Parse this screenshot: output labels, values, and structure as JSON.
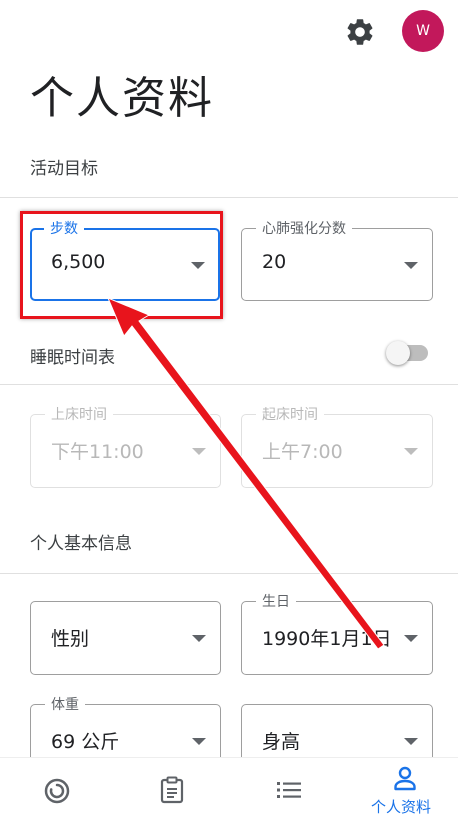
{
  "header": {
    "avatar_letter": "W",
    "page_title": "个人资料"
  },
  "goals": {
    "section_title": "活动目标",
    "steps": {
      "label": "步数",
      "value": "6,500"
    },
    "heart_points": {
      "label": "心肺强化分数",
      "value": "20"
    }
  },
  "sleep": {
    "section_title": "睡眠时间表",
    "toggle_on": false,
    "bedtime": {
      "label": "上床时间",
      "value": "下午11:00"
    },
    "wake_time": {
      "label": "起床时间",
      "value": "上午7:00"
    }
  },
  "basic_info": {
    "section_title": "个人基本信息",
    "gender": {
      "placeholder": "性别"
    },
    "birthday": {
      "label": "生日",
      "value": "1990年1月1日"
    },
    "weight": {
      "label": "体重",
      "value": "69 公斤"
    },
    "height": {
      "placeholder": "身高"
    }
  },
  "bottom_nav": {
    "items": [
      {
        "icon": "activity-ring-icon",
        "label": ""
      },
      {
        "icon": "journal-clipboard-icon",
        "label": ""
      },
      {
        "icon": "list-icon",
        "label": ""
      },
      {
        "icon": "person-icon",
        "label": "个人资料",
        "active": true
      }
    ]
  },
  "colors": {
    "accent": "#1a73e8",
    "avatar": "#c2185b",
    "annotation": "#e8141c"
  }
}
